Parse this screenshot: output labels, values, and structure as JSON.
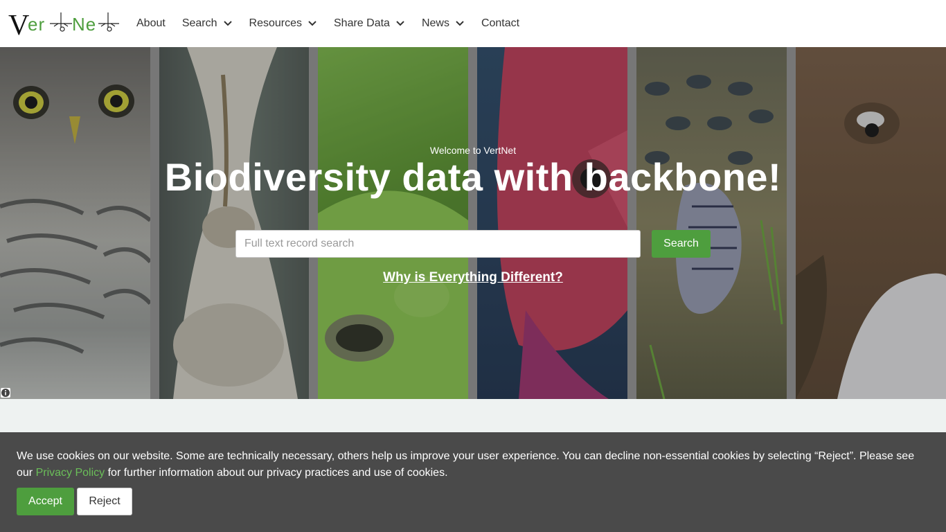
{
  "logo": {
    "part1": "Ver",
    "part2": "Ne",
    "alt": "VertNet logo"
  },
  "nav": {
    "items": [
      {
        "label": "About",
        "dropdown": false
      },
      {
        "label": "Search",
        "dropdown": true
      },
      {
        "label": "Resources",
        "dropdown": true
      },
      {
        "label": "Share Data",
        "dropdown": true
      },
      {
        "label": "News",
        "dropdown": true
      },
      {
        "label": "Contact",
        "dropdown": false
      }
    ]
  },
  "hero": {
    "welcome": "Welcome to VertNet",
    "headline": "Biodiversity data with backbone!",
    "search_placeholder": "Full text record search",
    "search_value": "",
    "search_button": "Search",
    "why_link": "Why is Everything Different?",
    "panels": [
      "owl",
      "bone",
      "frog",
      "fish",
      "snake",
      "mammal"
    ]
  },
  "cookie": {
    "text_before": "We use cookies on our website. Some are technically necessary, others help us improve your user experience. You can decline non-essential cookies by selecting “Reject”. Please see our ",
    "link": "Privacy Policy",
    "text_after": " for further information about our privacy practices and use of cookies.",
    "accept": "Accept",
    "reject": "Reject"
  },
  "colors": {
    "accent_green": "#4e9e3e",
    "link_green": "#6bbf59",
    "banner_bg": "#4a4a4a"
  }
}
